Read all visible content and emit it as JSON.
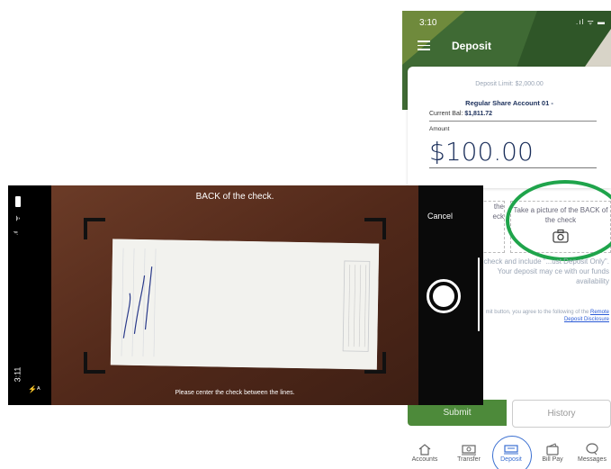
{
  "deposit_screen": {
    "status_time": "3:10",
    "status_icons": ".ıl ᯤ ▬",
    "title": "Deposit",
    "deposit_limit": "Deposit Limit: $2,000.00",
    "account_name": "Regular Share Account 01 -",
    "current_balance_label": "Current Bal:",
    "current_balance_value": "$1,811.72",
    "amount_label": "Amount",
    "amount_value": "$100.00",
    "front_text": "the\neck",
    "back_text": "Take a picture of the BACK of the check",
    "instructions": "check and include \"...ust Deposit Only\". Your deposit may ce with our funds availability",
    "agreement_text": "mit button, you agree to the following of the ",
    "agreement_link": "Remote Deposit Disclosure",
    "submit_label": "Submit",
    "history_label": "History",
    "nav": [
      {
        "label": "Accounts",
        "icon": "home-icon"
      },
      {
        "label": "Transfer",
        "icon": "transfer-icon"
      },
      {
        "label": "Deposit",
        "icon": "check-deposit-icon"
      },
      {
        "label": "Bill Pay",
        "icon": "wallet-icon"
      },
      {
        "label": "Messages",
        "icon": "chat-icon"
      }
    ],
    "colors": {
      "brand_green": "#3f6a34",
      "highlight_ring": "#1fa44b",
      "navy": "#1a2e5a",
      "link_blue": "#2a5ad6"
    }
  },
  "camera_screen": {
    "instruction_top": "BACK of the check.",
    "instruction_bottom": "Please center the check between the lines.",
    "cancel_label": "Cancel",
    "time": "3:11",
    "flash_label": "⚡ᴬ",
    "check_signature": "Remote Deposit Only"
  }
}
